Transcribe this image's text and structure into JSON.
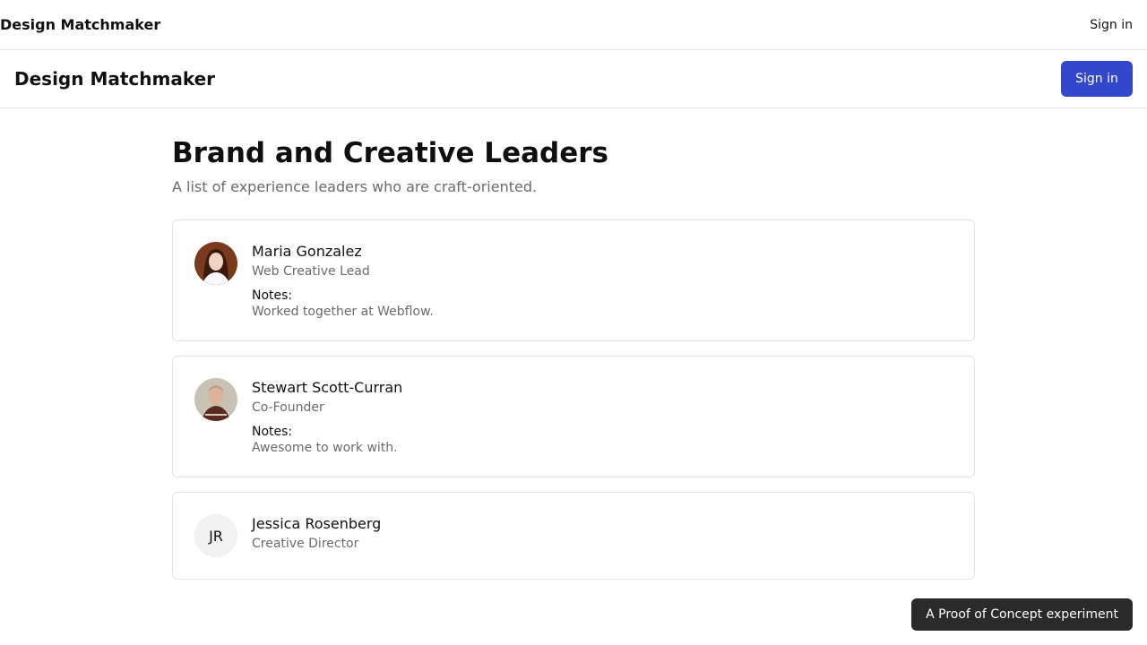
{
  "topbar": {
    "brand": "Design Matchmaker",
    "signin": "Sign in"
  },
  "appbar": {
    "brand": "Design Matchmaker",
    "signin": "Sign in"
  },
  "page": {
    "title": "Brand and Creative Leaders",
    "subtitle": "A list of experience leaders who are craft-oriented."
  },
  "people": [
    {
      "name": "Maria Gonzalez",
      "role": "Web Creative Lead",
      "notes_label": "Notes:",
      "notes": "Worked together at Webflow."
    },
    {
      "name": "Stewart Scott-Curran",
      "role": "Co-Founder",
      "notes_label": "Notes:",
      "notes": "Awesome to work with."
    },
    {
      "name": "Jessica Rosenberg",
      "role": "Creative Director",
      "initials": "JR"
    }
  ],
  "toast": {
    "text": "A Proof of Concept experiment"
  },
  "colors": {
    "primary": "#3347cc",
    "toast_bg": "#2a2a2a",
    "muted_text": "#6b6b6b"
  }
}
